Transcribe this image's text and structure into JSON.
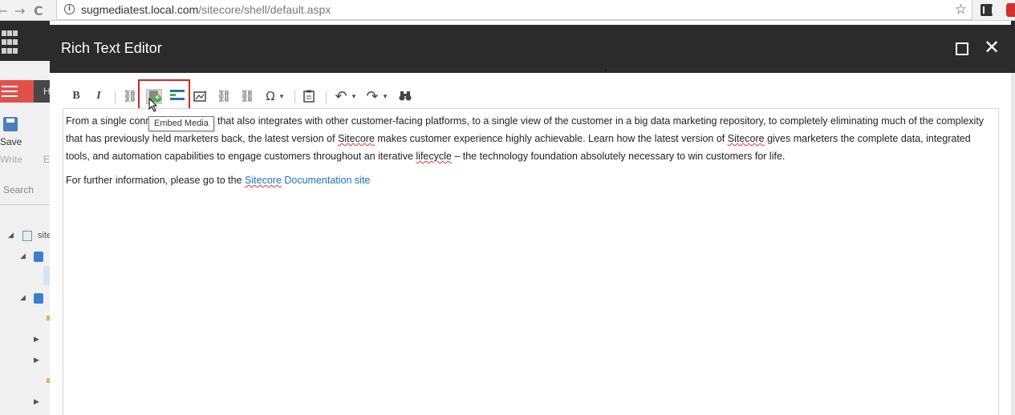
{
  "browser": {
    "back_arrow": "←",
    "forward_arrow": "→",
    "reload": "C",
    "url_host": "sugmediatest.local.com",
    "url_path": "/sitecore/shell/default.aspx",
    "star_glyph": "☆"
  },
  "background": {
    "ribbon_tab_partial": "H",
    "save_label": "Save",
    "write_label": "Write",
    "e_label": "E",
    "search_placeholder": "Search",
    "tree_site_partial": "site"
  },
  "dialog": {
    "title": "Rich Text Editor",
    "close_glyph": "✕"
  },
  "toolbar": {
    "bold": "B",
    "italic": "I",
    "omega": "Ω",
    "undo": "↶",
    "redo": "↷",
    "find": "⚯",
    "dropdown": "▾",
    "tooltip": "Embed Media"
  },
  "content": {
    "para1_a": "From a single connected platform that also integrates with other customer-facing platforms, to a single view of the customer in a big data marketing repository, to completely eliminating much of the complexity that has previously held marketers back, the latest version of ",
    "sitecore": "Sitecore",
    "para1_b": " makes customer experience highly achievable. Learn how the latest version of ",
    "para1_c": " gives marketers the complete data, integrated tools, and automation capabilities to engage customers throughout an iterative ",
    "lifecycle": "lifecycle",
    "para1_d": " – the technology foundation absolutely necessary to win customers for life.",
    "para2_text": "For further information, please go to the ",
    "link_text_a": "Sitecore",
    "link_text_b": " Documentation site"
  },
  "colors": {
    "header_bg": "#2b2b2b",
    "highlight": "#d9231f",
    "link": "#1a73c2",
    "sitecore_red": "#e2504a"
  }
}
